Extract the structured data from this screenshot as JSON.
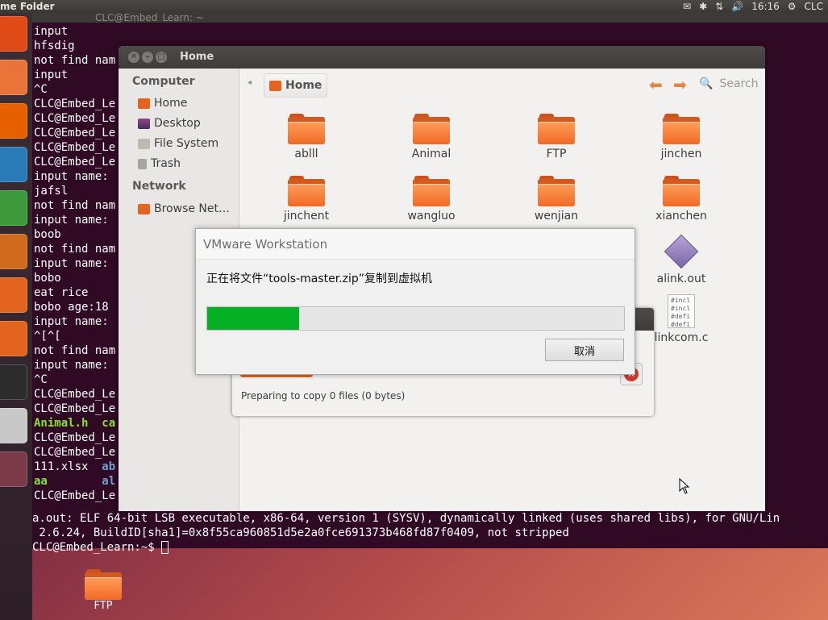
{
  "top_panel": {
    "app_title": "me Folder",
    "clock": "16:16",
    "user": "CLC",
    "indicators": {
      "mail": "mail-icon",
      "bluetooth": "bluetooth-icon",
      "network": "network-icon",
      "volume": "volume-icon",
      "power": "power-icon"
    }
  },
  "launcher": {
    "items": [
      {
        "name": "dash-icon",
        "color": "#df4a16"
      },
      {
        "name": "files-icon",
        "color": "#e8743a"
      },
      {
        "name": "firefox-icon",
        "color": "#e66000"
      },
      {
        "name": "writer-icon",
        "color": "#2a7ab8"
      },
      {
        "name": "calc-icon",
        "color": "#3c9a3c"
      },
      {
        "name": "impress-icon",
        "color": "#d06a1e"
      },
      {
        "name": "software-center-icon",
        "color": "#e2641e"
      },
      {
        "name": "ubuntu-one-icon",
        "color": "#e2641e"
      },
      {
        "name": "terminal-icon",
        "color": "#2c2c2c"
      },
      {
        "name": "system-settings-icon",
        "color": "#c8c8c8"
      },
      {
        "name": "workspace-switcher-icon",
        "color": "#7a3a4a"
      }
    ]
  },
  "terminal": {
    "title": "CLC@Embed_Learn: ~",
    "lines": [
      {
        "text": "input",
        "style": "normal"
      },
      {
        "text": "hfsdig",
        "style": "normal"
      },
      {
        "text": "not find nam",
        "style": "normal"
      },
      {
        "text": "input",
        "style": "normal"
      },
      {
        "text": "^C",
        "style": "normal"
      },
      {
        "text": "CLC@Embed_Le",
        "style": "normal"
      },
      {
        "text": "CLC@Embed_Le",
        "style": "normal"
      },
      {
        "text": "CLC@Embed_Le",
        "style": "normal"
      },
      {
        "text": "CLC@Embed_Le",
        "style": "normal"
      },
      {
        "text": "CLC@Embed_Le",
        "style": "normal"
      },
      {
        "text": "input name:",
        "style": "normal"
      },
      {
        "text": "jafsl",
        "style": "normal"
      },
      {
        "text": "not find nam",
        "style": "normal"
      },
      {
        "text": "input name:",
        "style": "normal"
      },
      {
        "text": "boob",
        "style": "normal"
      },
      {
        "text": "not find nam",
        "style": "normal"
      },
      {
        "text": "input name:",
        "style": "normal"
      },
      {
        "text": "bobo",
        "style": "normal"
      },
      {
        "text": "eat rice",
        "style": "normal"
      },
      {
        "text": "bobo age:18",
        "style": "normal"
      },
      {
        "text": "input name:",
        "style": "normal"
      },
      {
        "text": "^[^[",
        "style": "normal"
      },
      {
        "text": "not find nam",
        "style": "normal"
      },
      {
        "text": "input name:",
        "style": "normal"
      },
      {
        "text": "^C",
        "style": "normal"
      },
      {
        "text": "CLC@Embed_Le",
        "style": "normal"
      },
      {
        "text": "CLC@Embed_Le",
        "style": "normal"
      },
      {
        "text": "Animal.h  ca",
        "style": "green"
      },
      {
        "text": "CLC@Embed_Le",
        "style": "normal"
      },
      {
        "text": "CLC@Embed_Le",
        "style": "normal"
      },
      {
        "text": "111.xlsx  ",
        "style": "normal",
        "blue": "ab"
      },
      {
        "text": "aa        ",
        "style": "green",
        "blue": "al"
      },
      {
        "text": "CLC@Embed_Le",
        "style": "normal"
      }
    ],
    "tail": {
      "aout_line": "a.out: ELF 64-bit LSB executable, x86-64, version 1 (SYSV), dynamically linked (uses shared libs), for GNU/Lin",
      "build_line": " 2.6.24, BuildID[sha1]=0x8f55ca960851d5e2a0fce691373b468fd87f0409, not stripped",
      "prompt": "CLC@Embed_Learn:~$ "
    }
  },
  "file_manager": {
    "title": "Home",
    "sidebar": {
      "computer_heading": "Computer",
      "computer_items": [
        {
          "label": "Home",
          "icon": "home-folder-icon"
        },
        {
          "label": "Desktop",
          "icon": "desktop-icon"
        },
        {
          "label": "File System",
          "icon": "filesystem-icon"
        },
        {
          "label": "Trash",
          "icon": "trash-icon"
        }
      ],
      "network_heading": "Network",
      "network_items": [
        {
          "label": "Browse Net…",
          "icon": "network-folder-icon"
        }
      ]
    },
    "toolbar": {
      "breadcrumb": "Home",
      "search_label": "Search"
    },
    "items": [
      {
        "label": "ablll",
        "type": "folder"
      },
      {
        "label": "Animal",
        "type": "folder"
      },
      {
        "label": "FTP",
        "type": "folder"
      },
      {
        "label": "jinchen",
        "type": "folder"
      },
      {
        "label": "jinchent",
        "type": "folder"
      },
      {
        "label": "wangluo",
        "type": "folder"
      },
      {
        "label": "wenjian",
        "type": "folder"
      },
      {
        "label": "xianchen",
        "type": "folder"
      },
      {
        "label": "alink.out",
        "type": "executable"
      },
      {
        "label": "linkcom.c",
        "type": "c-source",
        "preview": [
          "#incl",
          "#incl",
          "#defi",
          "#defi"
        ]
      }
    ]
  },
  "copy_dialog": {
    "status": "Preparing to copy 0 files (0 bytes)"
  },
  "vmware_dialog": {
    "title": "VMware Workstation",
    "message": "正在将文件“tools-master.zip”复制到虚拟机",
    "progress_percent": 22,
    "progress_color": "#06b025",
    "cancel_label": "取消"
  },
  "desktop": {
    "icons": [
      {
        "label": "FTP",
        "type": "folder"
      }
    ]
  }
}
